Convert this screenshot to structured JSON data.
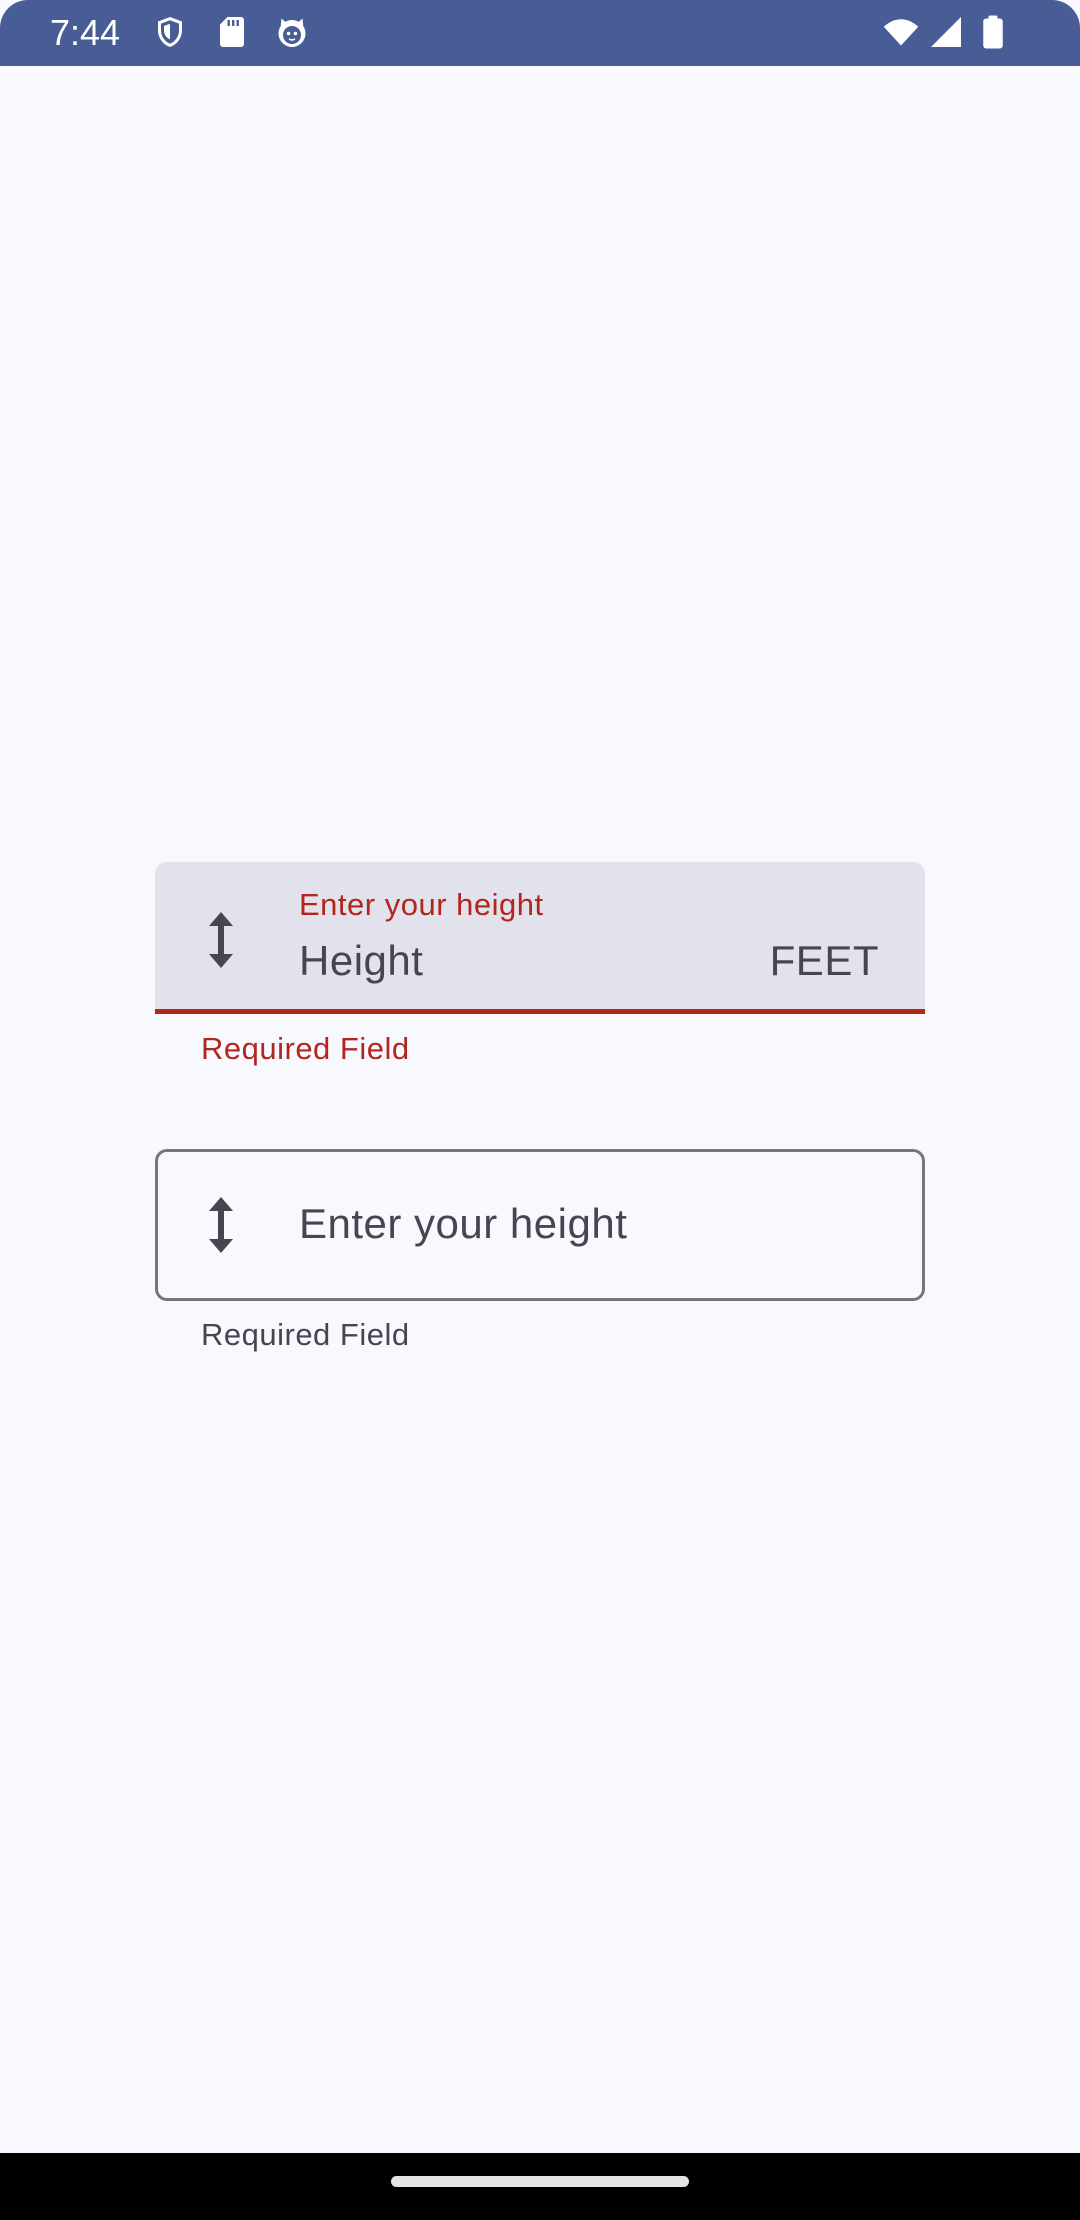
{
  "status_bar": {
    "time": "7:44",
    "background_color": "#485c95",
    "left_icons": [
      "shield-icon",
      "sd-card-icon",
      "cat-face-icon"
    ],
    "right_icons": [
      "wifi-icon",
      "cellular-signal-icon",
      "battery-icon"
    ]
  },
  "height_field_filled": {
    "label": "Enter your height",
    "placeholder": "Height",
    "suffix": "FEET",
    "supporting_text": "Required Field",
    "state": "error",
    "leading_icon": "vertical-resize-arrows-icon",
    "error_color": "#b3261e",
    "container_color": "#e2e2ec"
  },
  "height_field_outlined": {
    "label": "Enter your height",
    "supporting_text": "Required Field",
    "leading_icon": "vertical-resize-arrows-icon",
    "outline_color": "#767680"
  },
  "nav_bar": {
    "home_indicator": "home-gesture-pill"
  }
}
